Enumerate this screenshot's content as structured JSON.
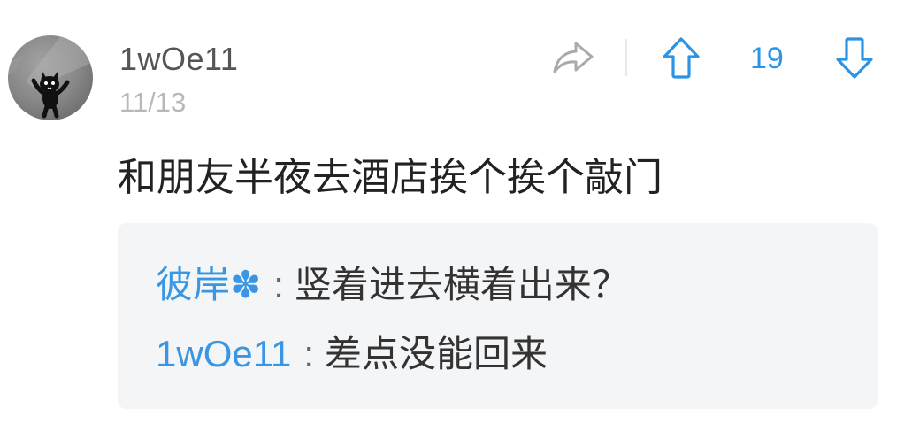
{
  "comment": {
    "author": "1wOe11",
    "date": "11/13",
    "text": "和朋友半夜去酒店挨个挨个敲门",
    "vote_count": "19"
  },
  "replies": [
    {
      "author": "彼岸✽",
      "separator": ":",
      "text": "竖着进去横着出来？"
    },
    {
      "author": "1wOe11",
      "separator": ":",
      "text": "差点没能回来"
    }
  ],
  "icons": {
    "avatar": "black-cat-avatar",
    "share": "share-icon",
    "upvote": "arrow-up-icon",
    "downvote": "arrow-down-icon"
  },
  "colors": {
    "accent": "#2a95e6",
    "author_gray": "#555555",
    "date_gray": "#b8b8b8",
    "share_icon_gray": "#aaaaaa",
    "text": "#222222",
    "reply_background": "#f4f5f7"
  }
}
